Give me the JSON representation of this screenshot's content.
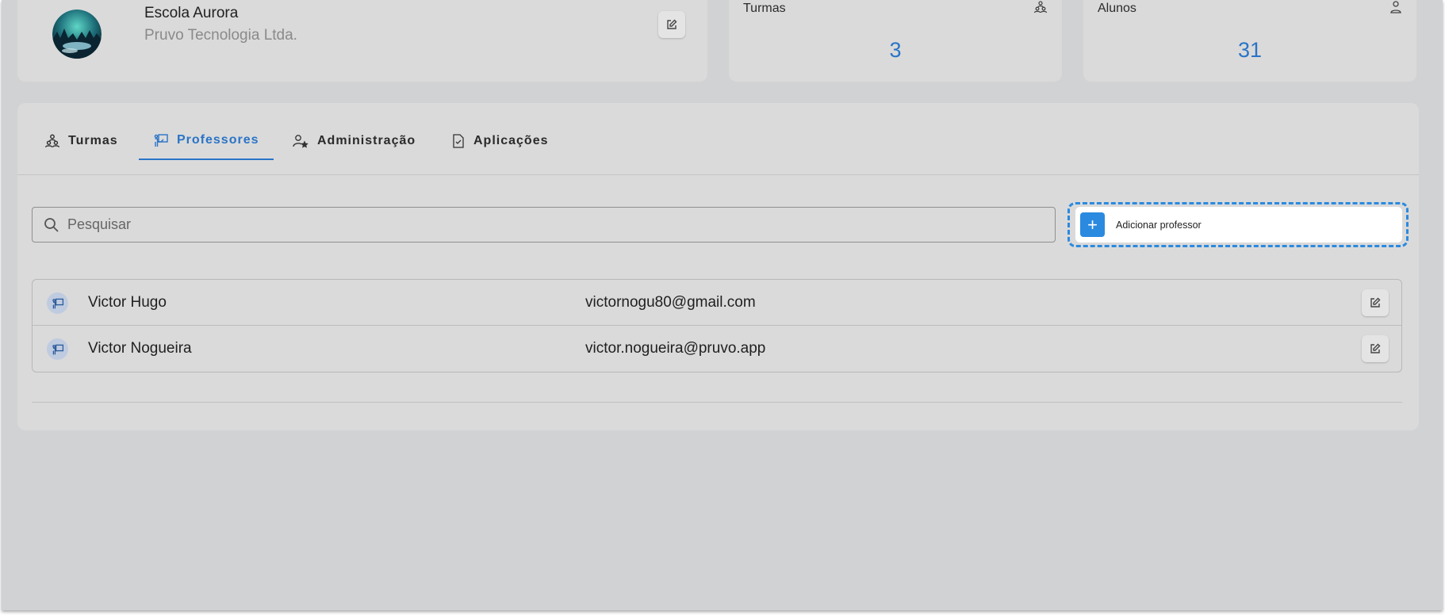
{
  "school": {
    "name": "Escola Aurora",
    "company": "Pruvo Tecnologia Ltda."
  },
  "stats": {
    "turmas": {
      "label": "Turmas",
      "value": "3",
      "icon": "group-icon"
    },
    "alunos": {
      "label": "Alunos",
      "value": "31",
      "icon": "person-icon"
    }
  },
  "tabs": [
    {
      "label": "Turmas",
      "icon": "group-icon",
      "active": false
    },
    {
      "label": "Professores",
      "icon": "teacher-icon",
      "active": true
    },
    {
      "label": "Administração",
      "icon": "person-star-icon",
      "active": false
    },
    {
      "label": "Aplicações",
      "icon": "document-check-icon",
      "active": false
    }
  ],
  "search": {
    "placeholder": "Pesquisar",
    "value": ""
  },
  "add_button": {
    "label": "Adicionar professor",
    "icon": "plus-icon"
  },
  "teachers": [
    {
      "name": "Victor Hugo",
      "email": "victornogu80@gmail.com"
    },
    {
      "name": "Victor Nogueira",
      "email": "victor.nogueira@pruvo.app"
    }
  ],
  "colors": {
    "accent": "#2a74c7",
    "button": "#2a8ae0",
    "background": "#d1d2d4",
    "card": "#dadada"
  }
}
